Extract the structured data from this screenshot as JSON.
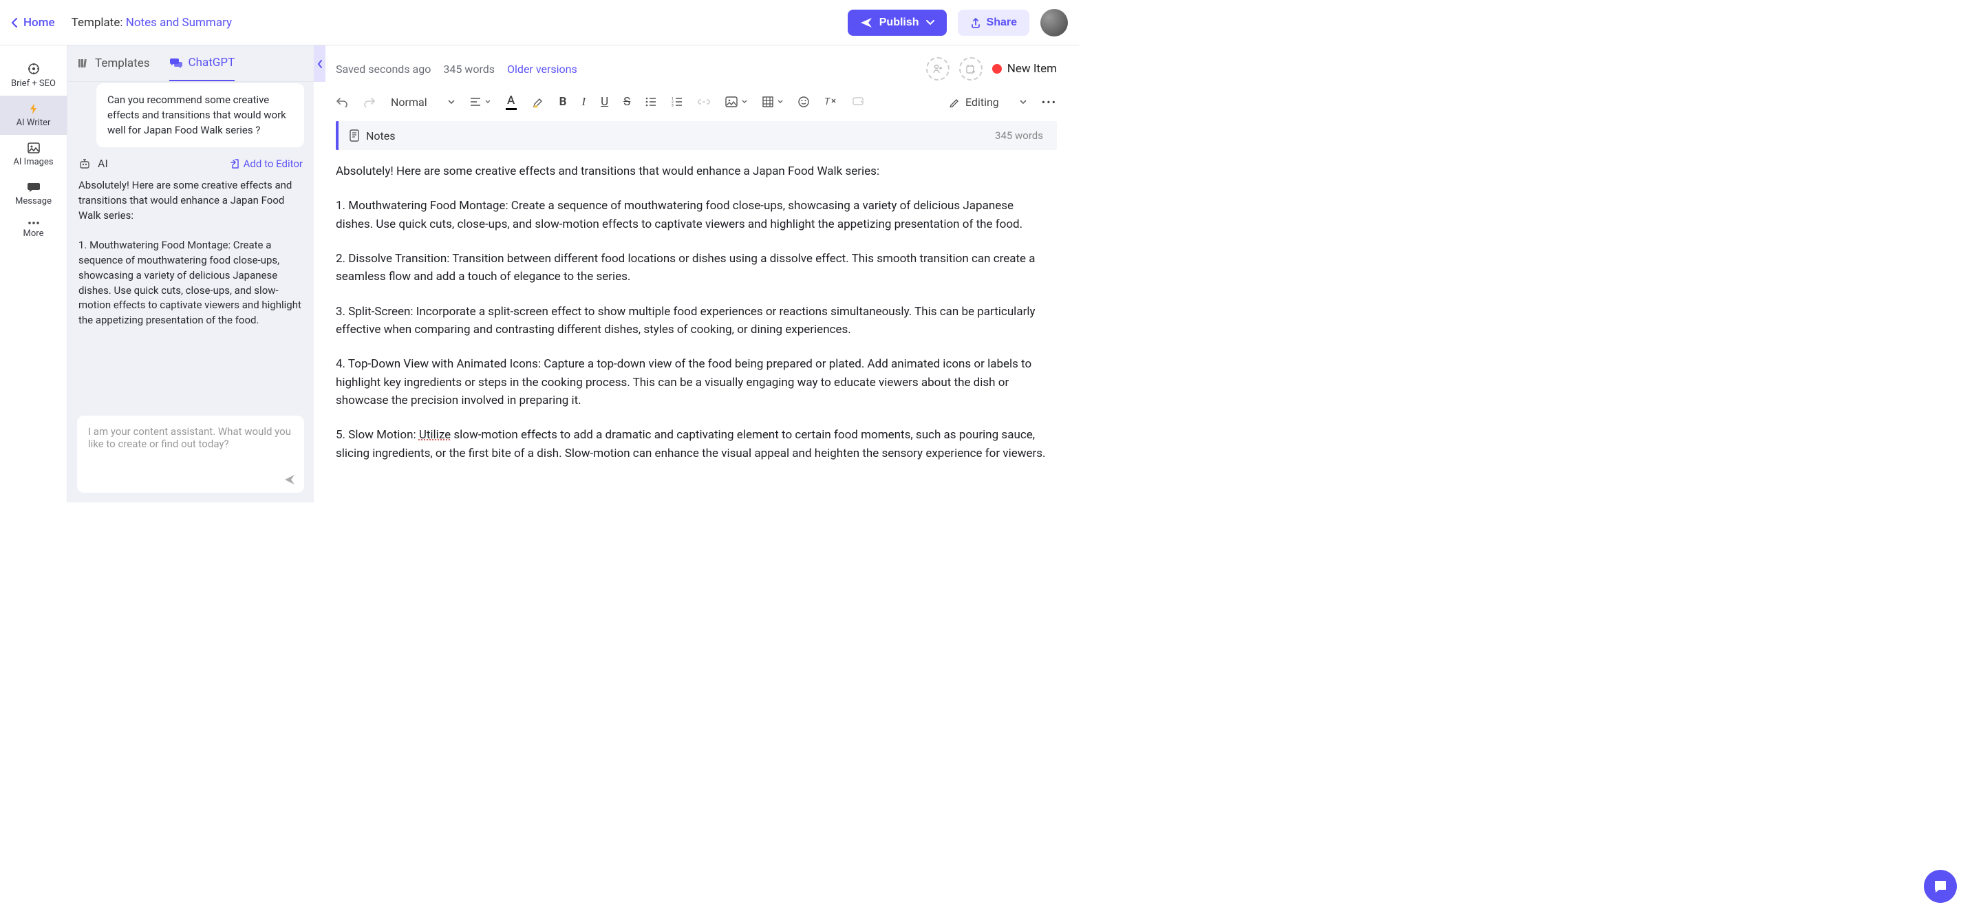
{
  "header": {
    "home": "Home",
    "template_prefix": "Template: ",
    "template_name": "Notes and Summary",
    "publish": "Publish",
    "share": "Share"
  },
  "rail": {
    "brief": "Brief + SEO",
    "writer": "AI Writer",
    "images": "AI Images",
    "message": "Message",
    "more": "More"
  },
  "chat": {
    "tab_templates": "Templates",
    "tab_chatgpt": "ChatGPT",
    "user_msg": "Can you recommend some creative effects and transitions that would work well for Japan Food Walk series ?",
    "ai_label": "AI",
    "add_to_editor": "Add to Editor",
    "ai_msg": "Absolutely! Here are some creative effects and transitions that would enhance a Japan Food Walk series:\n\n1. Mouthwatering Food Montage: Create a sequence of mouthwatering food close-ups, showcasing a variety of delicious Japanese dishes. Use quick cuts, close-ups, and slow-motion effects to captivate viewers and highlight the appetizing presentation of the food.",
    "input_placeholder": "I am your content assistant. What would you like to create or find out today?"
  },
  "status": {
    "saved": "Saved seconds ago",
    "words": "345 words",
    "older": "Older versions",
    "new_item": "New Item"
  },
  "toolbar": {
    "format": "Normal",
    "editing": "Editing"
  },
  "notes": {
    "title": "Notes",
    "words": "345 words"
  },
  "doc": {
    "p0": "Absolutely! Here are some creative effects and transitions that would enhance a Japan Food Walk series:",
    "p1": "1. Mouthwatering Food Montage: Create a sequence of mouthwatering food close-ups, showcasing a variety of delicious Japanese dishes. Use quick cuts, close-ups, and slow-motion effects to captivate viewers and highlight the appetizing presentation of the food.",
    "p2": "2. Dissolve Transition: Transition between different food locations or dishes using a dissolve effect. This smooth transition can create a seamless flow and add a touch of elegance to the series.",
    "p3": "3. Split-Screen: Incorporate a split-screen effect to show multiple food experiences or reactions simultaneously. This can be particularly effective when comparing and contrasting different dishes, styles of cooking, or dining experiences.",
    "p4": "4. Top-Down View with Animated Icons: Capture a top-down view of the food being prepared or plated. Add animated icons or labels to highlight key ingredients or steps in the cooking process. This can be a visually engaging way to educate viewers about the dish or showcase the precision involved in preparing it.",
    "p5a": "5. Slow Motion: ",
    "p5b": "Utilize",
    "p5c": " slow-motion effects to add a dramatic and captivating element to certain food moments, such as pouring sauce, slicing ingredients, or the first bite of a dish. Slow-motion can enhance the visual appeal and heighten the sensory experience for viewers."
  }
}
